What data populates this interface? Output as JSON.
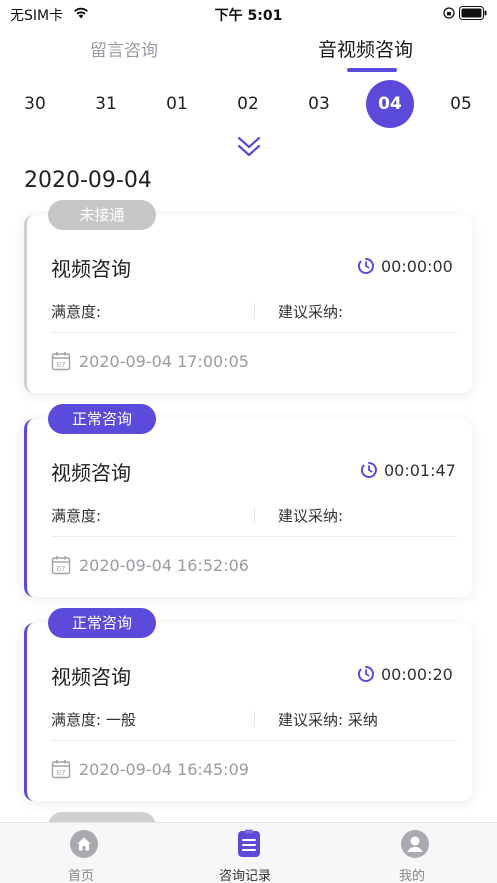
{
  "status_bar": {
    "carrier": "无SIM卡",
    "time": "下午 5:01"
  },
  "tabs": {
    "message": "留言咨询",
    "av": "音视频咨询"
  },
  "dates": [
    "30",
    "31",
    "01",
    "02",
    "03",
    "04",
    "05"
  ],
  "selected_date": "04",
  "day_title": "2020-09-04",
  "accent_color": "#5b4bdb",
  "cards": [
    {
      "badge": "未接通",
      "title": "视频咨询",
      "duration": "00:00:00",
      "satisfaction": "满意度:",
      "suggestion": "建议采纳:",
      "time": "2020-09-04 17:00:05"
    },
    {
      "badge": "正常咨询",
      "title": "视频咨询",
      "duration": "00:01:47",
      "satisfaction": "满意度:",
      "suggestion": "建议采纳:",
      "time": "2020-09-04 16:52:06"
    },
    {
      "badge": "正常咨询",
      "title": "视频咨询",
      "duration": "00:00:20",
      "satisfaction": "满意度:  一般",
      "suggestion": "建议采纳:  采纳",
      "time": "2020-09-04 16:45:09"
    }
  ],
  "tabbar": {
    "home": "首页",
    "records": "咨询记录",
    "mine": "我的"
  },
  "icons": [
    "wifi-icon",
    "lock-rotation-icon",
    "battery-icon",
    "chevron-double-down-icon",
    "clock-icon",
    "calendar-icon",
    "home-icon",
    "records-icon",
    "user-icon"
  ]
}
